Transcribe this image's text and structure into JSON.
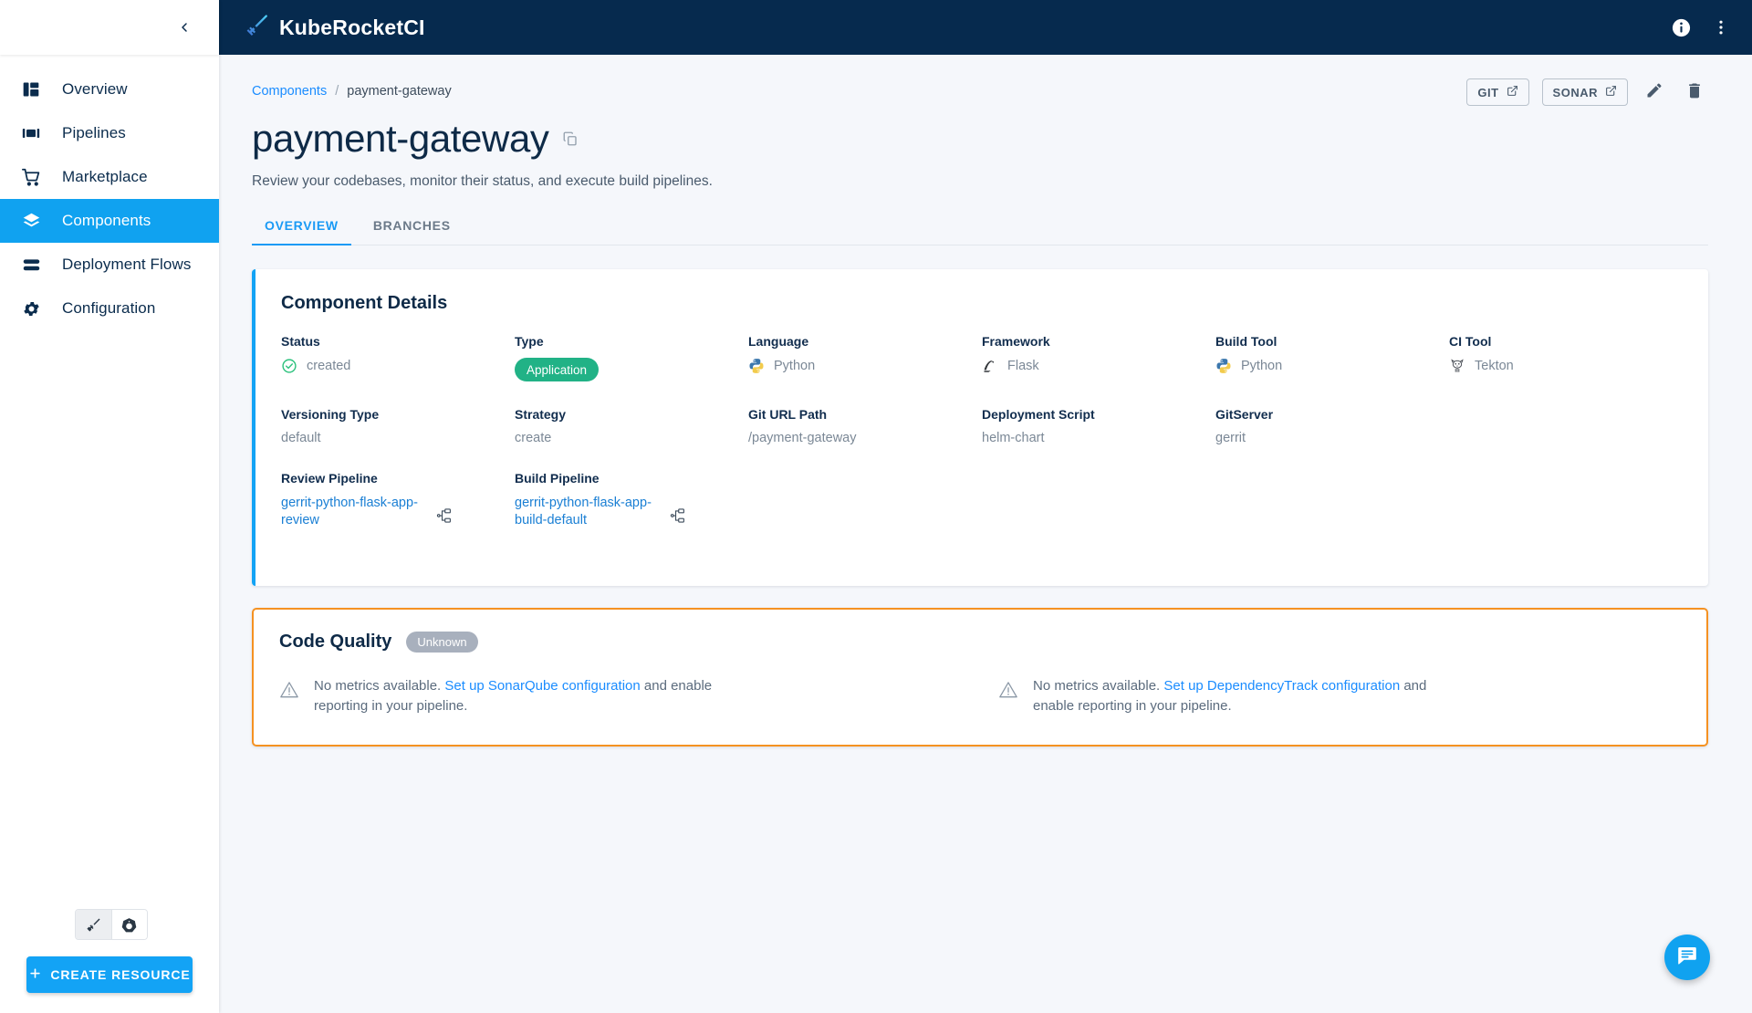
{
  "app": {
    "brand": "KubeRocketCI",
    "logo_icon": "rocket-sword-icon",
    "info_icon": "info-icon",
    "more_icon": "more-vertical-icon",
    "collapse_icon": "chevron-left-icon"
  },
  "sidebar": {
    "items": [
      {
        "label": "Overview",
        "icon": "dashboard-icon",
        "active": false
      },
      {
        "label": "Pipelines",
        "icon": "pipelines-icon",
        "active": false
      },
      {
        "label": "Marketplace",
        "icon": "cart-icon",
        "active": false
      },
      {
        "label": "Components",
        "icon": "layers-icon",
        "active": true
      },
      {
        "label": "Deployment Flows",
        "icon": "flows-icon",
        "active": false
      },
      {
        "label": "Configuration",
        "icon": "gear-icon",
        "active": false
      }
    ],
    "toggles": [
      {
        "icon": "sword-icon",
        "selected": true
      },
      {
        "icon": "kubernetes-icon",
        "selected": false
      }
    ],
    "create_button": {
      "label": "CREATE RESOURCE",
      "icon": "plus-icon"
    }
  },
  "breadcrumb": {
    "root": "Components",
    "separator": "/",
    "current": "payment-gateway"
  },
  "page": {
    "title": "payment-gateway",
    "copy_icon": "copy-icon",
    "subtitle": "Review your codebases, monitor their status, and execute build pipelines."
  },
  "actions": {
    "git": {
      "label": "GIT",
      "icon": "external-link-icon"
    },
    "sonar": {
      "label": "SONAR",
      "icon": "external-link-icon"
    },
    "edit": {
      "icon": "pencil-icon"
    },
    "delete": {
      "icon": "trash-icon"
    }
  },
  "tabs": [
    {
      "label": "OVERVIEW",
      "active": true
    },
    {
      "label": "BRANCHES",
      "active": false
    }
  ],
  "details": {
    "title": "Component Details",
    "accent_color": "#13a3f5",
    "fields": [
      {
        "label": "Status",
        "value": "created",
        "icon": "check-circle-icon"
      },
      {
        "label": "Type",
        "value": "Application",
        "render": "chip",
        "chip_color": "#21b286"
      },
      {
        "label": "Language",
        "value": "Python",
        "icon": "python-icon"
      },
      {
        "label": "Framework",
        "value": "Flask",
        "icon": "flask-icon"
      },
      {
        "label": "Build Tool",
        "value": "Python",
        "icon": "python-icon"
      },
      {
        "label": "CI Tool",
        "value": "Tekton",
        "icon": "tekton-cat-icon"
      },
      {
        "label": "Versioning Type",
        "value": "default"
      },
      {
        "label": "Strategy",
        "value": "create"
      },
      {
        "label": "Git URL Path",
        "value": "/payment-gateway"
      },
      {
        "label": "Deployment Script",
        "value": "helm-chart"
      },
      {
        "label": "GitServer",
        "value": "gerrit"
      }
    ],
    "pipelines": [
      {
        "label": "Review Pipeline",
        "value": "gerrit-python-flask-app-review",
        "icon": "pipeline-tree-icon"
      },
      {
        "label": "Build Pipeline",
        "value": "gerrit-python-flask-app-build-default",
        "icon": "pipeline-tree-icon"
      }
    ]
  },
  "code_quality": {
    "title": "Code Quality",
    "badge": "Unknown",
    "border_color": "#f59222",
    "messages": [
      {
        "icon": "warning-triangle-icon",
        "prefix": "No metrics available. ",
        "link": "Set up SonarQube configuration",
        "suffix": " and enable reporting in your pipeline."
      },
      {
        "icon": "warning-triangle-icon",
        "prefix": "No metrics available. ",
        "link": "Set up DependencyTrack configuration",
        "suffix": " and enable reporting in your pipeline."
      }
    ]
  },
  "fab": {
    "icon": "chat-icon"
  }
}
